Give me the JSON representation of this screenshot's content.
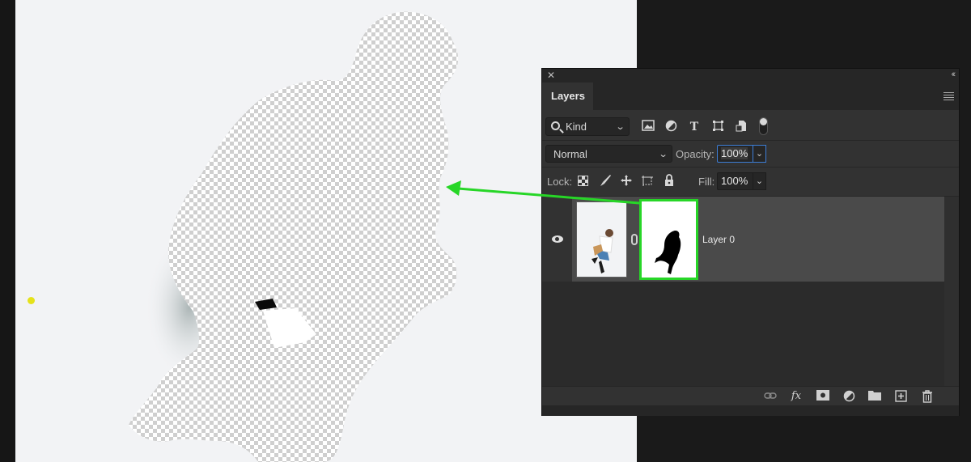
{
  "panel": {
    "close_glyph": "✕",
    "collapse_glyph": "‹‹",
    "tabs": [
      {
        "label": "Layers",
        "active": true
      }
    ],
    "filter": {
      "kind_label": "Kind",
      "icons": [
        "image-filter-icon",
        "adjustment-filter-icon",
        "type-filter-icon",
        "shape-filter-icon",
        "smart-object-filter-icon"
      ],
      "filter_toggle": "on"
    },
    "blend_mode": "Normal",
    "opacity_label": "Opacity:",
    "opacity_value": "100%",
    "lock_label": "Lock:",
    "lock_icons": [
      "lock-transparent-pixels-icon",
      "lock-image-pixels-icon",
      "lock-position-icon",
      "lock-artboard-icon",
      "lock-all-icon"
    ],
    "fill_label": "Fill:",
    "fill_value": "100%",
    "layers": [
      {
        "name": "Layer 0",
        "visible": true,
        "has_mask": true,
        "mask_selected": true,
        "linked": true
      }
    ],
    "bottom_icons": [
      "link-layers-icon",
      "layer-style-icon",
      "add-mask-icon",
      "adjustment-layer-icon",
      "new-group-icon",
      "new-layer-icon",
      "delete-layer-icon"
    ]
  },
  "annotation": {
    "arrow_color": "#27d627",
    "highlight_color": "#27d627"
  },
  "canvas": {
    "background_color": "#f2f3f5"
  }
}
